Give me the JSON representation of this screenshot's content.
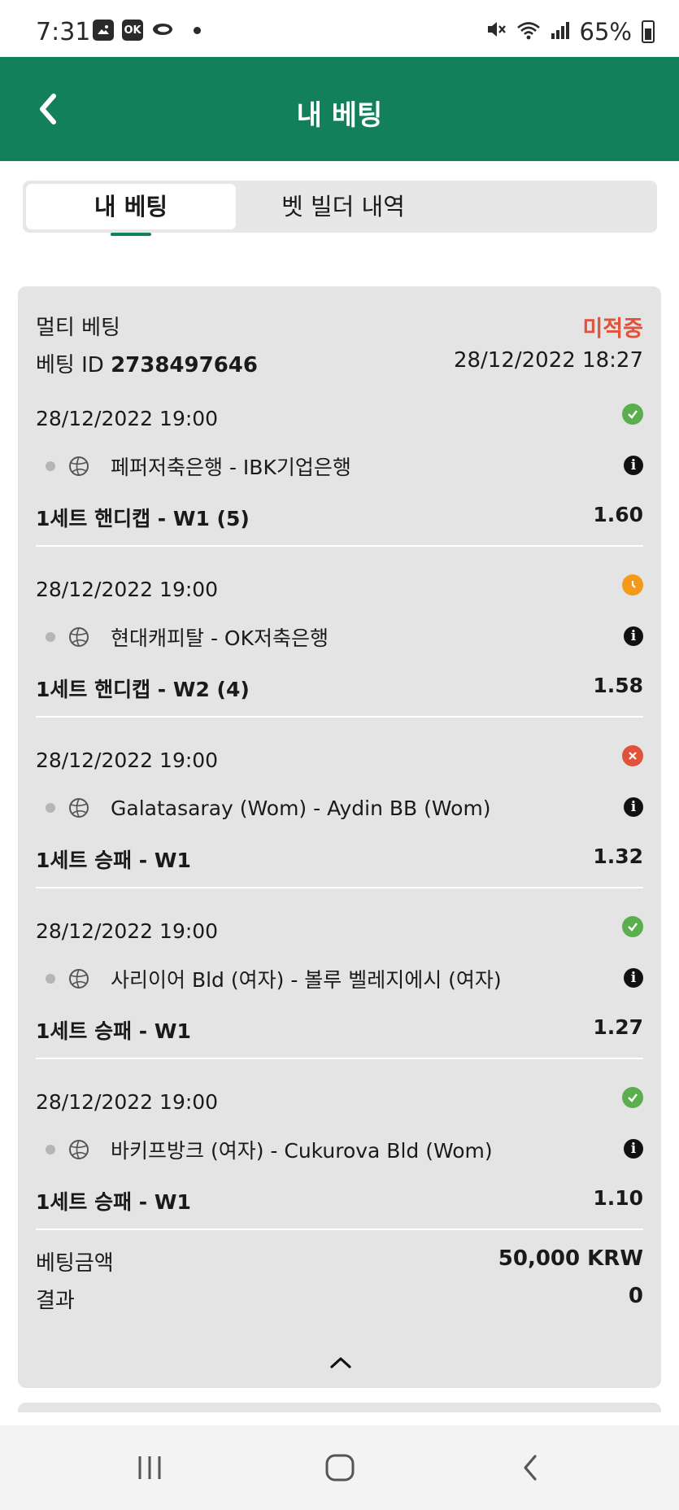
{
  "status_bar": {
    "time": "7:31",
    "notification_icons": [
      "gallery-icon",
      "ok-app-icon",
      "cloud-icon"
    ],
    "battery": "65%"
  },
  "header": {
    "title": "내 베팅",
    "back_icon": "chevron-left-icon",
    "bg_color": "#12805a"
  },
  "tabs": [
    {
      "label": "내 베팅",
      "active": true
    },
    {
      "label": "벳 빌더 내역",
      "active": false
    }
  ],
  "bet": {
    "type": "멀티 베팅",
    "status": "미적중",
    "id_label": "베팅 ID",
    "id": "2738497646",
    "placed_at": "28/12/2022 18:27",
    "selections": [
      {
        "date": "28/12/2022 19:00",
        "result": "won",
        "match": "페퍼저축은행 - IBK기업은행",
        "market": "1세트 핸디캡 - W1 (5)",
        "odds": "1.60"
      },
      {
        "date": "28/12/2022 19:00",
        "result": "pending",
        "match": "현대캐피탈 - OK저축은행",
        "market": "1세트 핸디캡 - W2 (4)",
        "odds": "1.58"
      },
      {
        "date": "28/12/2022 19:00",
        "result": "lost",
        "match": "Galatasaray (Wom) - Aydin BB (Wom)",
        "market": "1세트 승패 - W1",
        "odds": "1.32"
      },
      {
        "date": "28/12/2022 19:00",
        "result": "won",
        "match": "사리이어 Bld (여자) - 볼루 벨레지에시 (여자)",
        "market": "1세트 승패 - W1",
        "odds": "1.27"
      },
      {
        "date": "28/12/2022 19:00",
        "result": "won",
        "match": "바키프방크 (여자) - Cukurova Bld (Wom)",
        "market": "1세트 승패 - W1",
        "odds": "1.10"
      }
    ],
    "stake_label": "베팅금액",
    "stake": "50,000 KRW",
    "result_label": "결과",
    "result_value": "0"
  },
  "colors": {
    "won": "#5aae4e",
    "pending": "#f39a1b",
    "lost": "#e0533a",
    "status_lost_text": "#e0533a"
  }
}
